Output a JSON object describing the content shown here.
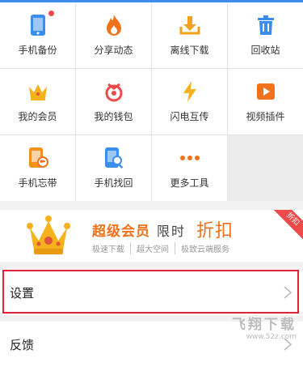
{
  "grid": [
    {
      "label": "手机备份",
      "icon": "phone-backup-icon",
      "badge": true
    },
    {
      "label": "分享动态",
      "icon": "flame-icon"
    },
    {
      "label": "离线下载",
      "icon": "download-tray-icon"
    },
    {
      "label": "回收站",
      "icon": "trash-icon"
    },
    {
      "label": "我的会员",
      "icon": "crown-icon"
    },
    {
      "label": "我的钱包",
      "icon": "wallet-icon"
    },
    {
      "label": "闪电互传",
      "icon": "lightning-icon"
    },
    {
      "label": "视频插件",
      "icon": "video-play-icon"
    },
    {
      "label": "手机忘带",
      "icon": "phone-cloud-icon"
    },
    {
      "label": "手机找回",
      "icon": "phone-search-icon"
    },
    {
      "label": "更多工具",
      "icon": "more-dots-icon"
    }
  ],
  "promo": {
    "title_a": "超级会员",
    "title_b": "限时",
    "title_c": "折扣",
    "features": [
      "极速下载",
      "超大空间",
      "极致云端服务"
    ],
    "ribbon": "折扣"
  },
  "settings": {
    "label": "设置"
  },
  "feedback": {
    "label": "反馈"
  },
  "watermark": {
    "name": "飞翔下载",
    "url": "www.52z.com"
  },
  "colors": {
    "accent_blue": "#3b8df0",
    "accent_orange": "#f2721c",
    "highlight_red": "#e2233b"
  }
}
